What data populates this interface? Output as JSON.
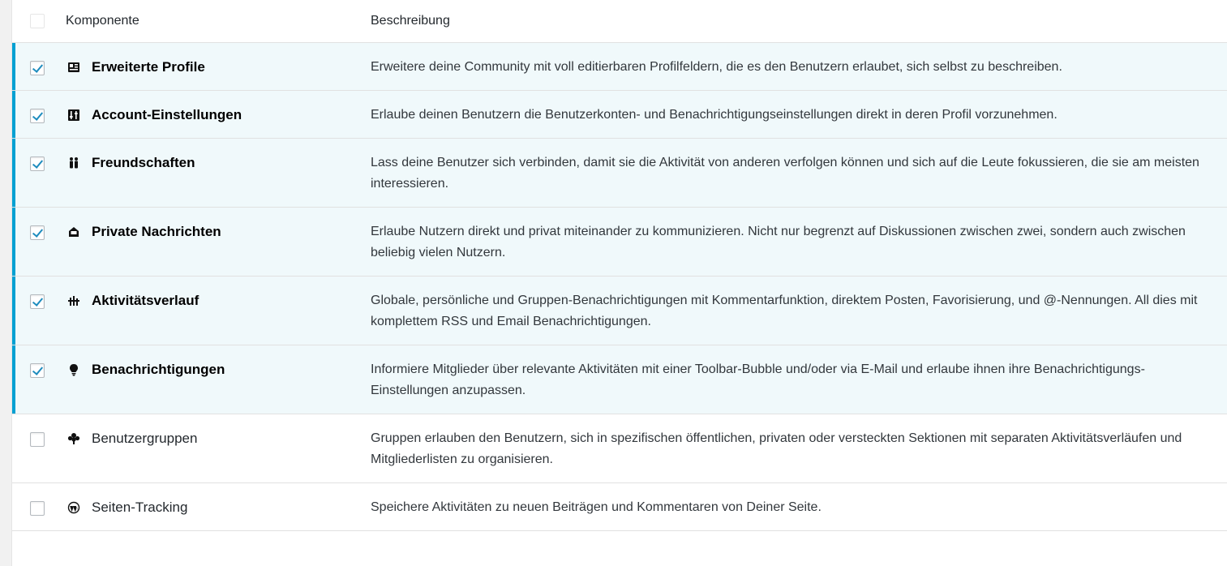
{
  "table": {
    "header": {
      "component": "Komponente",
      "description": "Beschreibung"
    },
    "rows": [
      {
        "name": "Erweiterte Profile",
        "description": "Erweitere deine Community mit voll editierbaren Profilfeldern, die es den Benutzern erlaubet, sich selbst zu beschreiben.",
        "checked": true,
        "icon": "profile-card-icon"
      },
      {
        "name": "Account-Einstellungen",
        "description": "Erlaube deinen Benutzern die Benutzerkonten- und Benachrichtigungseinstellungen direkt in deren Profil vorzunehmen.",
        "checked": true,
        "icon": "settings-panel-icon"
      },
      {
        "name": "Freundschaften",
        "description": "Lass deine Benutzer sich verbinden, damit sie die Aktivität von anderen verfolgen können und sich auf die Leute fokussieren, die sie am meisten interessieren.",
        "checked": true,
        "icon": "friends-icon"
      },
      {
        "name": "Private Nachrichten",
        "description": "Erlaube Nutzern direkt und privat miteinander zu kommunizieren. Nicht nur begrenzt auf Diskussionen zwischen zwei, sondern auch zwischen beliebig vielen Nutzern.",
        "checked": true,
        "icon": "inbox-icon"
      },
      {
        "name": "Aktivitätsverlauf",
        "description": "Globale, persönliche und Gruppen-Benachrichtigungen mit Kommentarfunktion, direktem Posten, Favorisierung, und @-Nennungen. All dies mit komplettem RSS und Email Benachrichtigungen.",
        "checked": true,
        "icon": "activity-icon"
      },
      {
        "name": "Benachrichtigungen",
        "description": "Informiere Mitglieder über relevante Aktivitäten mit einer Toolbar-Bubble und/oder via E-Mail und erlaube ihnen ihre Benachrichtigungs-Einstellungen anzupassen.",
        "checked": true,
        "icon": "lightbulb-icon"
      },
      {
        "name": "Benutzergruppen",
        "description": "Gruppen erlauben den Benutzern, sich in spezifischen öffentlichen, privaten oder versteckten Sektionen mit separaten Aktivitätsverläufen und Mitgliederlisten zu organisieren.",
        "checked": false,
        "icon": "groups-icon"
      },
      {
        "name": "Seiten-Tracking",
        "description": "Speichere Aktivitäten zu neuen Beiträgen und Kommentaren von Deiner Seite.",
        "checked": false,
        "icon": "wordpress-icon"
      }
    ]
  },
  "colors": {
    "accent": "#00a0d2",
    "active_row_bg": "#f0f9fb",
    "check": "#1e8cbe"
  }
}
